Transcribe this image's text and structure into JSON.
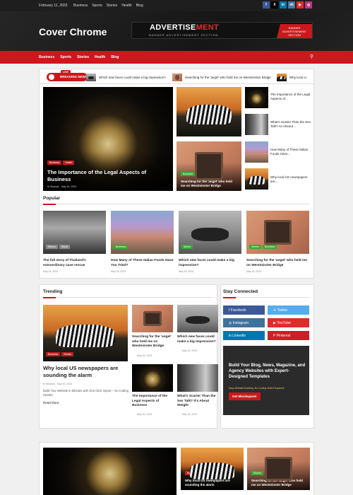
{
  "topbar": {
    "date": "February 11, 2025",
    "nav": [
      "Business",
      "Sports",
      "Stories",
      "Health",
      "Blog"
    ],
    "social": [
      {
        "icon": "facebook-icon",
        "glyph": "f",
        "color": "#3b5998"
      },
      {
        "icon": "x-icon",
        "glyph": "X",
        "color": "#000000"
      },
      {
        "icon": "linkedin-icon",
        "glyph": "in",
        "color": "#0077b5"
      },
      {
        "icon": "vk-icon",
        "glyph": "vk",
        "color": "#4a76a8"
      },
      {
        "icon": "youtube-icon",
        "glyph": "▶",
        "color": "#e02b2b"
      },
      {
        "icon": "instagram-icon",
        "glyph": "◎",
        "color": "#c13584"
      }
    ]
  },
  "header": {
    "logo": "Cover Chrome",
    "ad_title_a": "ADVERTISE",
    "ad_title_b": "MENT",
    "ad_subtitle": "BANNER ADVERTISEMENT SECTION",
    "ad_badge": [
      "BANNER",
      "ADVERTISEMENT",
      "SECTION"
    ]
  },
  "nav": {
    "items": [
      "Business",
      "Sports",
      "Stories",
      "Health",
      "Blog"
    ],
    "search_icon": "search-icon"
  },
  "ticker": {
    "live": "LIVE",
    "label": "BREAKING NEWS",
    "items": [
      "Which new faces could make a big impression?",
      "Searching for the 'angel' who held me on Westminster Bridge",
      "Why local U"
    ]
  },
  "hero": {
    "tags": [
      "Business",
      "Health"
    ],
    "title": "The Importance of the Legal Aspects of Business",
    "author": "M Shaman",
    "date": "May 16, 2024"
  },
  "hero_grid": [
    {
      "tags": [
        "Business",
        "Health"
      ],
      "title": "Searching for the 'angel' who held me on Westminster Bridge"
    }
  ],
  "hero_side": [
    "The Importance of the Legal Aspects of...",
    "What's Scarier Than the Sex Talk? An Absout...",
    "How Many of These Italian Foods Have...",
    "Why local US newspapers are..."
  ],
  "popular": {
    "title": "Popular",
    "items": [
      {
        "tags": [
          "Stories",
          "World"
        ],
        "title": "The full story of Thailand's extraordinary cave rescue",
        "meta": "May 16, 2024"
      },
      {
        "tags": [
          "Business"
        ],
        "title": "How Many of These Italian Foods Have You Tried?",
        "meta": "May 16, 2024"
      },
      {
        "tags": [
          "Sports"
        ],
        "title": "Which new faces could make a big impression?",
        "meta": "May 16, 2024"
      },
      {
        "tags": [
          "Stories",
          "Business"
        ],
        "title": "Searching for the 'angel' who held me on Westminster Bridge",
        "meta": "May 16, 2024"
      }
    ]
  },
  "trending": {
    "title": "Trending",
    "main": {
      "tags": [
        "Business",
        "Stories"
      ],
      "title": "Why local US newspapers are sounding the alarm",
      "author": "M Shaman",
      "date": "May 16, 2024",
      "excerpt": "Build Your Website in Minutes with One-Click Import – No Coding Hassle!",
      "more": "Read More.."
    },
    "items": [
      {
        "title": "Searching for the 'angel' who held me on Westminster Bridge",
        "date": "May 16, 2024"
      },
      {
        "title": "Which new faces could make a big impression?",
        "date": "May 16, 2024"
      },
      {
        "title": "The Importance of the Legal Aspects of Business",
        "date": "May 16, 2024"
      },
      {
        "title": "What's Scarier Than the Sex Talk? It's About Weight",
        "date": "May 16, 2024"
      }
    ]
  },
  "stay": {
    "title": "Stay Connected",
    "buttons": [
      {
        "label": "Facebook",
        "color": "#3b5998",
        "icon": "facebook-icon"
      },
      {
        "label": "Twitter",
        "color": "#55acee",
        "icon": "twitter-icon"
      },
      {
        "label": "Instagram",
        "color": "#3f729b",
        "icon": "instagram-icon"
      },
      {
        "label": "YouTube",
        "color": "#e02b2b",
        "icon": "youtube-icon"
      },
      {
        "label": "LinkedIn",
        "color": "#0077b5",
        "icon": "linkedin-icon"
      },
      {
        "label": "Pinterest",
        "color": "#cb2027",
        "icon": "pinterest-icon"
      }
    ],
    "promo_title": "Build Your Blog, News, Magazine, and Agency Websites with Expert-Designed Templates",
    "promo_sub": "Easy Website Building: No Coding Skills Required!",
    "promo_btn": "Get Blockspare!"
  },
  "bottom": {
    "tags1": [
      "Business",
      "Stories"
    ],
    "title1": "Why local US newspapers are sounding the alarm",
    "tags2": [
      "Stories",
      "Business"
    ],
    "title2": "Searching for the 'angel' who held me on Westminster Bridge"
  }
}
